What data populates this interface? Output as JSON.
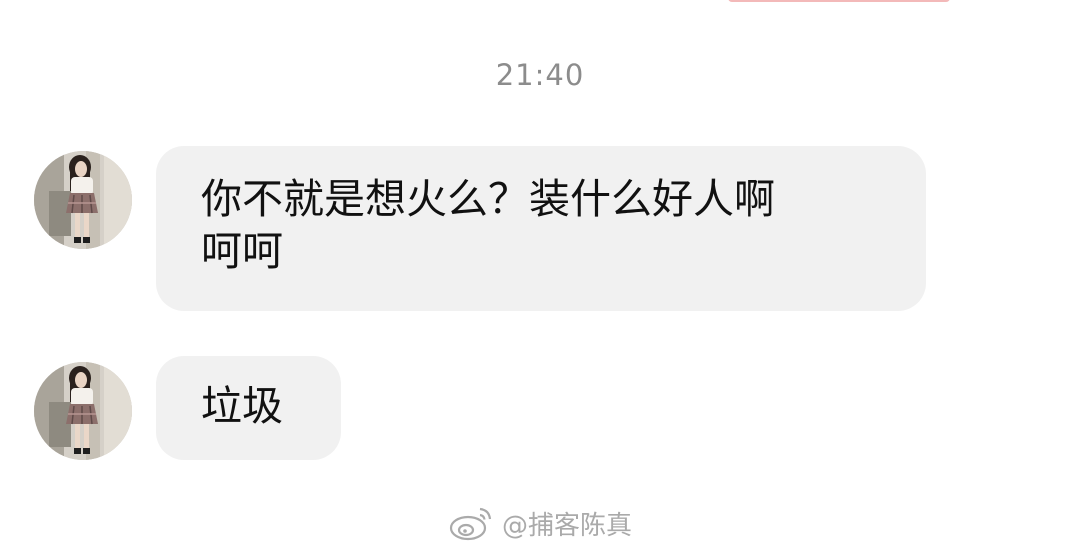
{
  "chat": {
    "timestamp": "21:40",
    "messages": [
      {
        "sender_avatar": "avatar-girl",
        "text": "你不就是想火么？装什么好人啊\n呵呵"
      },
      {
        "sender_avatar": "avatar-girl",
        "text": "垃圾"
      }
    ]
  },
  "watermark": {
    "text": "@捕客陈真",
    "icon": "weibo-logo-icon"
  },
  "colors": {
    "background": "#ffffff",
    "bubble": "#f1f1f1",
    "timestamp": "#8c8c8c",
    "message_text": "#111111",
    "watermark": "#a6a6a6"
  }
}
